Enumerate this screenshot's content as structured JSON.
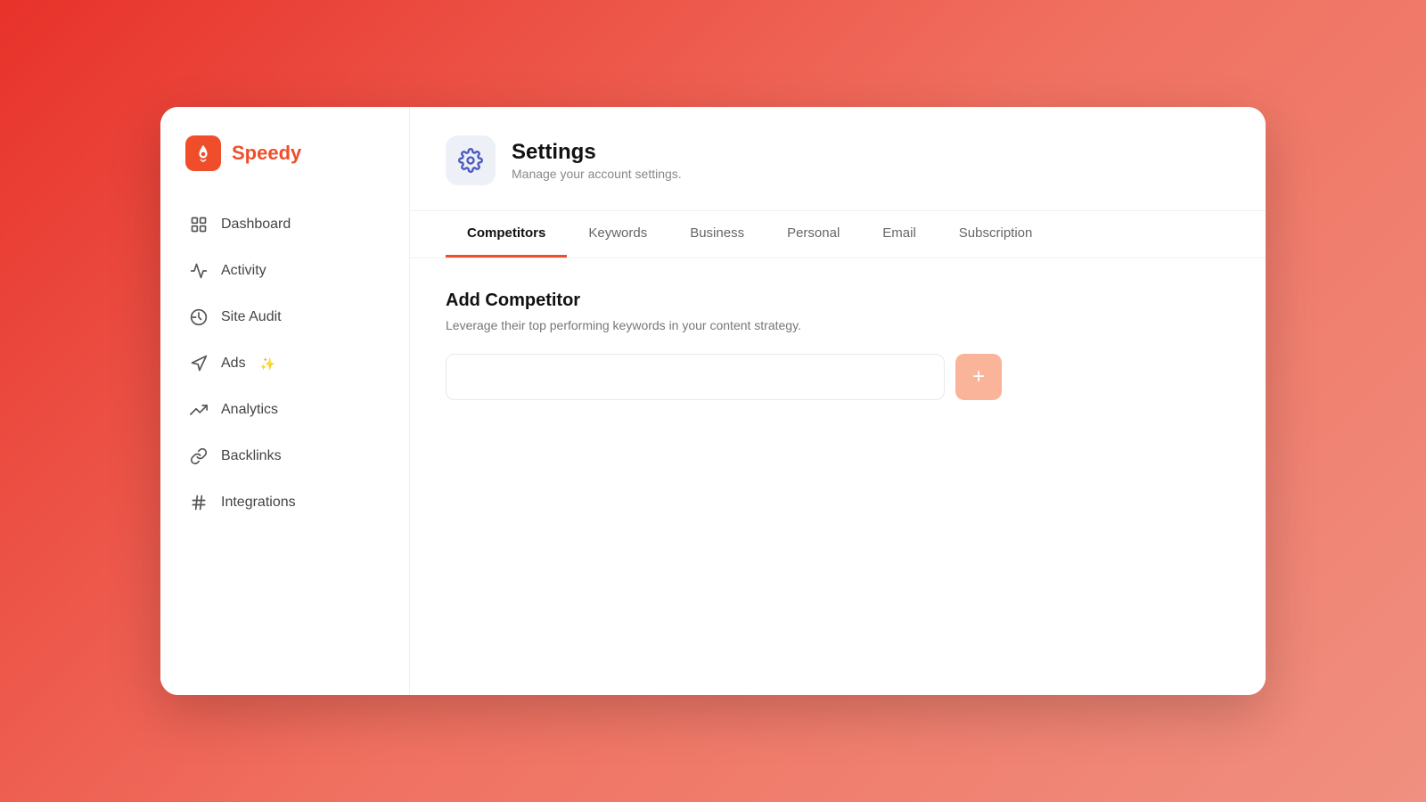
{
  "app": {
    "logo_text": "Speedy",
    "logo_icon": "🚀"
  },
  "sidebar": {
    "items": [
      {
        "id": "dashboard",
        "label": "Dashboard",
        "icon": "dashboard"
      },
      {
        "id": "activity",
        "label": "Activity",
        "icon": "activity"
      },
      {
        "id": "site-audit",
        "label": "Site Audit",
        "icon": "site-audit"
      },
      {
        "id": "ads",
        "label": "Ads",
        "icon": "ads",
        "badge": "✨"
      },
      {
        "id": "analytics",
        "label": "Analytics",
        "icon": "analytics"
      },
      {
        "id": "backlinks",
        "label": "Backlinks",
        "icon": "backlinks"
      },
      {
        "id": "integrations",
        "label": "Integrations",
        "icon": "integrations"
      }
    ]
  },
  "header": {
    "title": "Settings",
    "subtitle": "Manage your account settings."
  },
  "tabs": [
    {
      "id": "competitors",
      "label": "Competitors",
      "active": true
    },
    {
      "id": "keywords",
      "label": "Keywords",
      "active": false
    },
    {
      "id": "business",
      "label": "Business",
      "active": false
    },
    {
      "id": "personal",
      "label": "Personal",
      "active": false
    },
    {
      "id": "email",
      "label": "Email",
      "active": false
    },
    {
      "id": "subscription",
      "label": "Subscription",
      "active": false
    }
  ],
  "competitors_tab": {
    "section_title": "Add Competitor",
    "section_desc": "Leverage their top performing keywords in your content strategy.",
    "input_placeholder": "",
    "add_button_label": "+"
  }
}
